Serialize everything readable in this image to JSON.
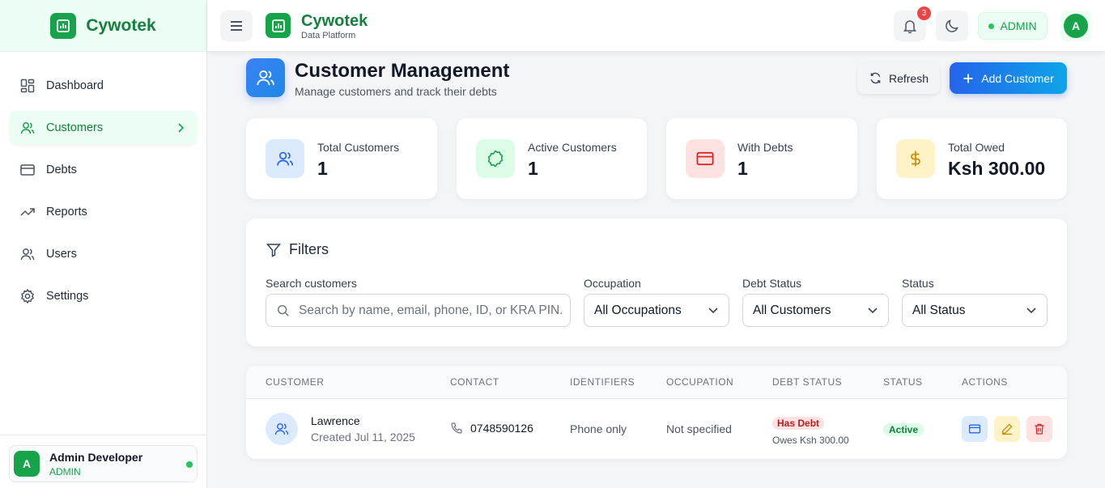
{
  "brand": {
    "name": "Cywotek",
    "subtitle": "Data Platform"
  },
  "sidebar": {
    "items": [
      {
        "label": "Dashboard",
        "icon": "dashboard-icon"
      },
      {
        "label": "Customers",
        "icon": "users-icon",
        "active": true
      },
      {
        "label": "Debts",
        "icon": "credit-card-icon"
      },
      {
        "label": "Reports",
        "icon": "trending-up-icon"
      },
      {
        "label": "Users",
        "icon": "users-icon"
      },
      {
        "label": "Settings",
        "icon": "gear-icon"
      }
    ],
    "user": {
      "initial": "A",
      "name": "Admin Developer",
      "role": "ADMIN"
    }
  },
  "topbar": {
    "notification_count": "3",
    "role_pill": "ADMIN",
    "avatar_initial": "A"
  },
  "page": {
    "title": "Customer Management",
    "subtitle": "Manage customers and track their debts",
    "refresh_label": "Refresh",
    "add_label": "Add Customer"
  },
  "stats": [
    {
      "label": "Total Customers",
      "value": "1"
    },
    {
      "label": "Active Customers",
      "value": "1"
    },
    {
      "label": "With Debts",
      "value": "1"
    },
    {
      "label": "Total Owed",
      "value": "Ksh 300.00"
    }
  ],
  "filters": {
    "title": "Filters",
    "search_label": "Search customers",
    "search_placeholder": "Search by name, email, phone, ID, or KRA PIN...",
    "occupation_label": "Occupation",
    "occupation_value": "All Occupations",
    "debt_status_label": "Debt Status",
    "debt_status_value": "All Customers",
    "status_label": "Status",
    "status_value": "All Status"
  },
  "table": {
    "columns": [
      "CUSTOMER",
      "CONTACT",
      "IDENTIFIERS",
      "OCCUPATION",
      "DEBT STATUS",
      "STATUS",
      "ACTIONS"
    ],
    "rows": [
      {
        "name": "Lawrence",
        "created": "Created Jul 11, 2025",
        "phone": "0748590126",
        "identifiers": "Phone only",
        "occupation": "Not specified",
        "debt_badge": "Has Debt",
        "debt_owes": "Owes Ksh 300.00",
        "status": "Active"
      }
    ]
  },
  "colors": {
    "brand_green": "#16a34a",
    "primary_blue": "#2563eb",
    "debt_red": "#dc2626",
    "active_green": "#15803d"
  }
}
